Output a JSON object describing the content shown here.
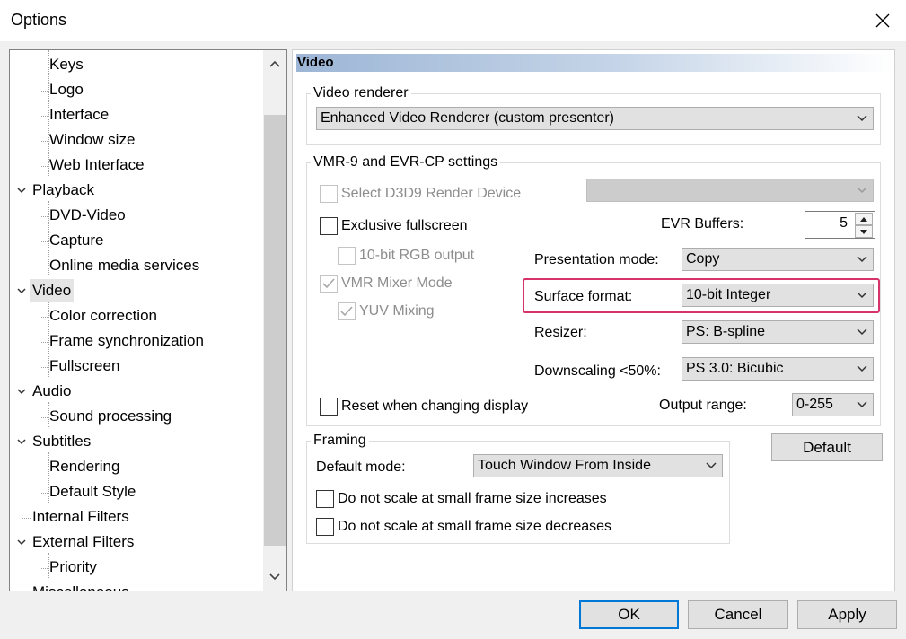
{
  "window": {
    "title": "Options"
  },
  "tree": {
    "items": [
      {
        "label": "Keys",
        "level": 2
      },
      {
        "label": "Logo",
        "level": 2
      },
      {
        "label": "Interface",
        "level": 2
      },
      {
        "label": "Window size",
        "level": 2
      },
      {
        "label": "Web Interface",
        "level": 2
      },
      {
        "label": "Playback",
        "level": 1,
        "expanded": true
      },
      {
        "label": "DVD-Video",
        "level": 2
      },
      {
        "label": "Capture",
        "level": 2
      },
      {
        "label": "Online media services",
        "level": 2
      },
      {
        "label": "Video",
        "level": 1,
        "expanded": true,
        "selected": true
      },
      {
        "label": "Color correction",
        "level": 2
      },
      {
        "label": "Frame synchronization",
        "level": 2
      },
      {
        "label": "Fullscreen",
        "level": 2
      },
      {
        "label": "Audio",
        "level": 1,
        "expanded": true
      },
      {
        "label": "Sound processing",
        "level": 2
      },
      {
        "label": "Subtitles",
        "level": 1,
        "expanded": true
      },
      {
        "label": "Rendering",
        "level": 2
      },
      {
        "label": "Default Style",
        "level": 2
      },
      {
        "label": "Internal Filters",
        "level": 1
      },
      {
        "label": "External Filters",
        "level": 1,
        "expanded": true
      },
      {
        "label": "Priority",
        "level": 2
      },
      {
        "label": "Miscellaneous",
        "level": 1
      }
    ]
  },
  "page": {
    "header": "Video",
    "renderer": {
      "legend": "Video renderer",
      "value": "Enhanced Video Renderer (custom presenter)"
    },
    "vmr": {
      "legend": "VMR-9 and EVR-CP settings",
      "d3d9_label": "Select D3D9 Render Device",
      "d3d9_value": "",
      "exclusive_label": "Exclusive fullscreen",
      "rgb10_label": "10-bit RGB output",
      "mixer_label": "VMR Mixer Mode",
      "yuv_label": "YUV Mixing",
      "reset_label": "Reset when changing display",
      "evr_buffers_label": "EVR Buffers:",
      "evr_buffers_value": "5",
      "presentation_label": "Presentation mode:",
      "presentation_value": "Copy",
      "surface_label": "Surface format:",
      "surface_value": "10-bit Integer",
      "resizer_label": "Resizer:",
      "resizer_value": "PS: B-spline",
      "downscaling_label": "Downscaling <50%:",
      "downscaling_value": "PS 3.0: Bicubic",
      "output_range_label": "Output range:",
      "output_range_value": "0-255"
    },
    "framing": {
      "legend": "Framing",
      "default_mode_label": "Default mode:",
      "default_mode_value": "Touch Window From Inside",
      "no_scale_increase_label": "Do not scale at small frame size increases",
      "no_scale_decrease_label": "Do not scale at small frame size decreases"
    },
    "default_button": "Default"
  },
  "buttons": {
    "ok": "OK",
    "cancel": "Cancel",
    "apply": "Apply"
  },
  "colors": {
    "highlight": "#d6336c",
    "accent": "#0078d7"
  }
}
